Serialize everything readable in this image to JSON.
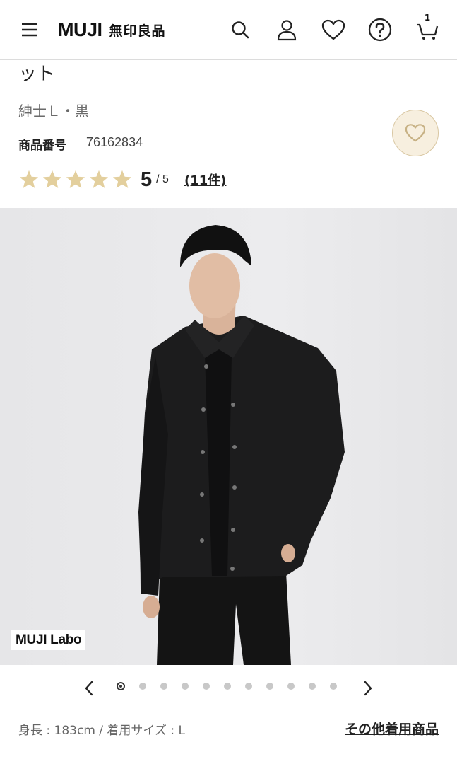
{
  "header": {
    "logo_en": "MUJI",
    "logo_jp": "無印良品",
    "cart_count": "1",
    "icons": [
      "menu-icon",
      "search-icon",
      "account-icon",
      "heart-icon",
      "help-icon",
      "cart-icon"
    ]
  },
  "product": {
    "title_tail": "ット",
    "variant": "紳士Ｌ・黒",
    "sku_label": "商品番号",
    "sku_value": "76162834",
    "rating_score": "5",
    "rating_denominator": "/ 5",
    "rating_stars": 5,
    "review_count": "(11件)"
  },
  "gallery": {
    "brand_tag": "MUJI Labo",
    "total_images": 11,
    "active_index": 0
  },
  "model_info": {
    "text": "身長 : 183cm / 着用サイズ : L",
    "other_items_link": "その他着用商品"
  },
  "colors": {
    "star": "#e3cf9d",
    "fav_bg": "#f7efdf",
    "text": "#222222"
  }
}
